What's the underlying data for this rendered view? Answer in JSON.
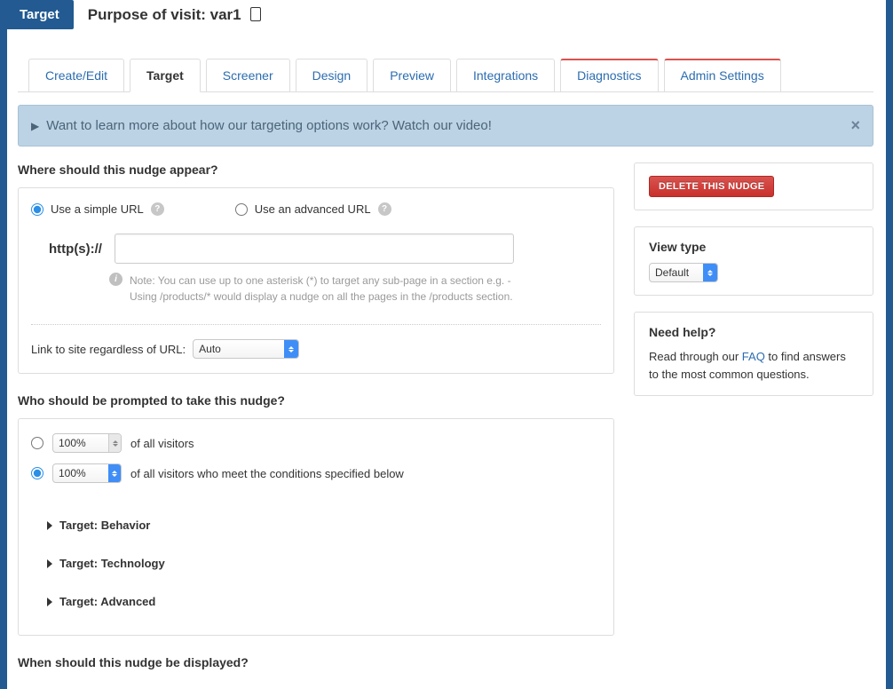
{
  "header": {
    "badge": "Target",
    "title": "Purpose of visit: var1"
  },
  "tabs": [
    "Create/Edit",
    "Target",
    "Screener",
    "Design",
    "Preview",
    "Integrations",
    "Diagnostics",
    "Admin Settings"
  ],
  "alert": {
    "text": "Want to learn more about how our targeting options work? Watch our video!"
  },
  "sections": {
    "where": {
      "title": "Where should this nudge appear?",
      "simple_label": "Use a simple URL",
      "advanced_label": "Use an advanced URL",
      "url_prefix": "http(s)://",
      "url_value": "",
      "note": "Note: You can use up to one asterisk (*) to target any sub-page in a section e.g. - Using /products/* would display a nudge on all the pages in the /products section.",
      "link_label": "Link to site regardless of URL:",
      "link_value": "Auto"
    },
    "who": {
      "title": "Who should be prompted to take this nudge?",
      "pct1": "100%",
      "opt1_suffix": "of all visitors",
      "pct2": "100%",
      "opt2_suffix": "of all visitors who meet the conditions specified below",
      "acc1": "Target: Behavior",
      "acc2": "Target: Technology",
      "acc3": "Target: Advanced"
    },
    "when": {
      "title": "When should this nudge be displayed?"
    }
  },
  "sidebar": {
    "delete_label": "DELETE THIS NUDGE",
    "view_type_title": "View type",
    "view_type_value": "Default",
    "help_title": "Need help?",
    "help_text_before": "Read through our ",
    "help_link": "FAQ",
    "help_text_after": " to find answers to the most common questions."
  }
}
